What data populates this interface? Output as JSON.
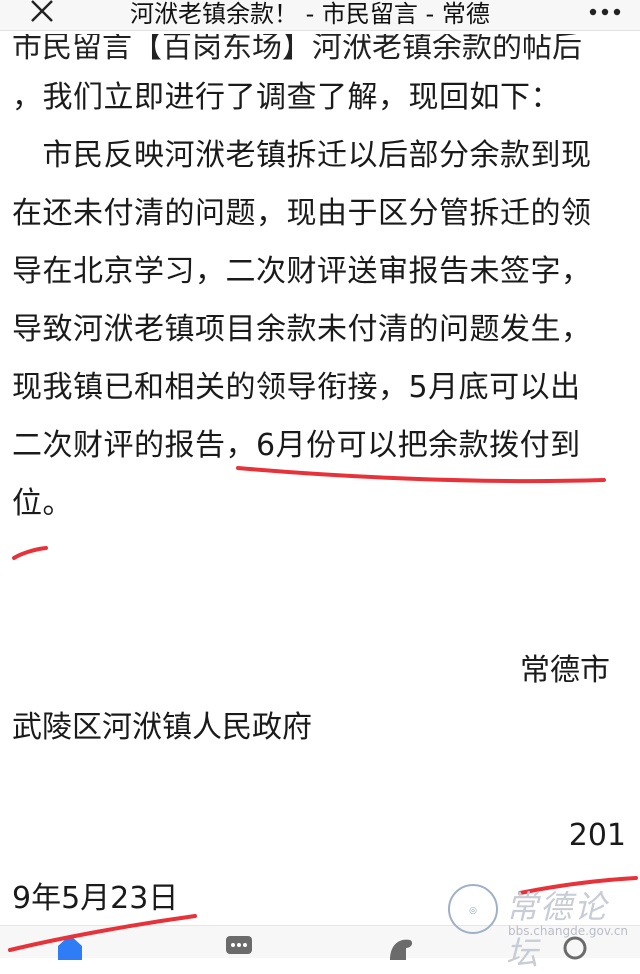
{
  "header": {
    "title": "河洑老镇余款！ - 市民留言 - 常德"
  },
  "content": {
    "cut_line": "市民留言【百岗东场】河洑老镇余款的帖后",
    "lines": [
      "，我们立即进行了调查了解，现回如下：",
      "　市民反映河洑老镇拆迁以后部分余款到现",
      "在还未付清的问题，现由于区分管拆迁的领",
      "导在北京学习，二次财评送审报告未签字，",
      "导致河洑老镇项目余款未付清的问题发生，",
      "现我镇已和相关的领导衔接，5月底可以出",
      "二次财评的报告，6月份可以把余款拨付到",
      "位。"
    ],
    "signature_city": "常德市",
    "signature_org": "武陵区河洑镇人民政府",
    "date_part1": "201",
    "date_part2": "9年5月23日"
  },
  "watermark": {
    "name": "常德论坛",
    "url": "bbs.changde.gov.cn"
  },
  "bottom_nav": {
    "items": [
      "home-icon",
      "chat-icon",
      "discover-icon",
      "profile-icon"
    ]
  },
  "colors": {
    "annotation_red": "#e8323a",
    "nav_active": "#2f7df6",
    "nav_inactive": "#6b6b6b"
  }
}
